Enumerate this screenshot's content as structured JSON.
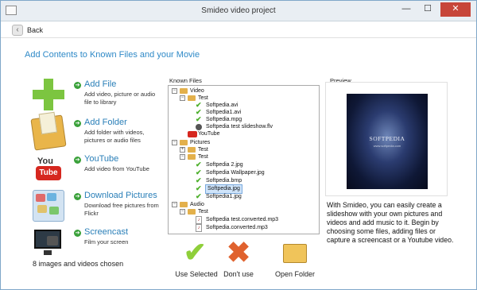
{
  "window": {
    "title": "Smideo video project",
    "controls": {
      "minimize": "—",
      "maximize": "☐",
      "close": "✕"
    }
  },
  "nav": {
    "back_label": "Back"
  },
  "heading": "Add Contents to Known Files and your Movie",
  "actions": [
    {
      "label": "Add File",
      "desc": "Add video, picture or audio file to library",
      "icon": "add-plus-icon"
    },
    {
      "label": "Add Folder",
      "desc": "Add folder with videos, pictures or audio files",
      "icon": "folder-icon"
    },
    {
      "label": "YouTube",
      "desc": "Add video from YouTube",
      "icon": "youtube-icon"
    },
    {
      "label": "Download Pictures",
      "desc": "Download free pictures from Flickr",
      "icon": "pictures-icon"
    },
    {
      "label": "Screencast",
      "desc": "Film your screen",
      "icon": "screencast-icon"
    }
  ],
  "youtube_icon_text": {
    "top": "You",
    "bottom": "Tube"
  },
  "chosen_text": "8 images and videos chosen",
  "known_files": {
    "title": "Known Files",
    "tree": [
      {
        "label": "Video",
        "type": "folder",
        "toggle": "−"
      },
      {
        "label": "Test",
        "type": "folder",
        "toggle": "−"
      },
      {
        "label": "Softpedia.avi",
        "type": "checked"
      },
      {
        "label": "Softpedia1.avi",
        "type": "checked"
      },
      {
        "label": "Softpedia.mpg",
        "type": "checked"
      },
      {
        "label": "Softpedia test slideshow.flv",
        "type": "play"
      },
      {
        "label": "YouTube",
        "type": "youtube"
      },
      {
        "label": "Pictures",
        "type": "folder",
        "toggle": "−"
      },
      {
        "label": "Test",
        "type": "folder",
        "toggle": "+"
      },
      {
        "label": "Test",
        "type": "folder",
        "toggle": "−"
      },
      {
        "label": "Softpedia 2.jpg",
        "type": "checked"
      },
      {
        "label": "Softpedia Wallpaper.jpg",
        "type": "checked"
      },
      {
        "label": "Softpedia.bmp",
        "type": "checked"
      },
      {
        "label": "Softpedia.jpg",
        "type": "checked",
        "selected": true
      },
      {
        "label": "Softpedia1.jpg",
        "type": "checked"
      },
      {
        "label": "Audio",
        "type": "folder",
        "toggle": "−"
      },
      {
        "label": "Test",
        "type": "folder",
        "toggle": "−"
      },
      {
        "label": "Softpedia test.converted.mp3",
        "type": "audio"
      },
      {
        "label": "Softpedia.converted.mp3",
        "type": "audio"
      }
    ]
  },
  "buttons": {
    "use_selected": "Use Selected",
    "dont_use": "Don't use",
    "open_folder": "Open Folder"
  },
  "preview": {
    "title": "Preview",
    "logo_text": "SOFTPEDIA",
    "logo_sub": "www.softpedia.com",
    "info": "With Smideo, you can easily create a slideshow with your own pictures and videos and add music to it. Begin by choosing some files, adding files or capture a screencast or a Youtube video."
  }
}
